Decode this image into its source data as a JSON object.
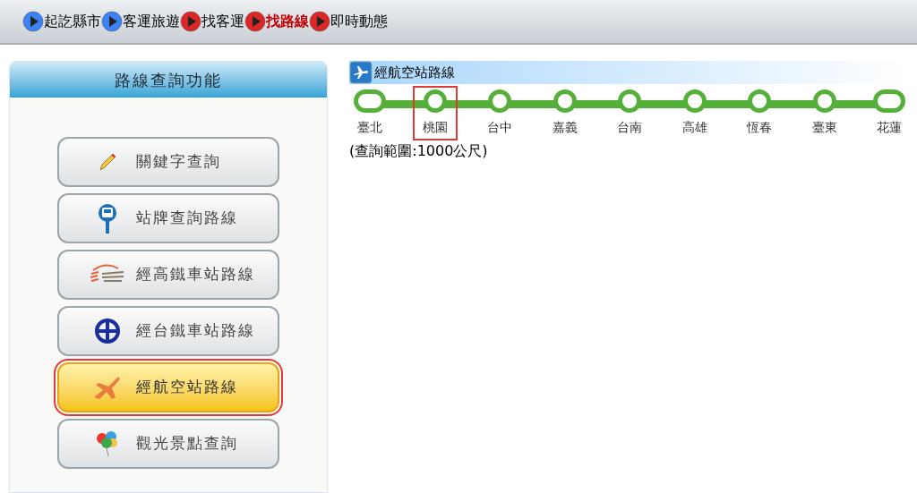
{
  "nav": [
    {
      "label": "起訖縣市",
      "color": "#3b82f6",
      "selected": false
    },
    {
      "label": "客運旅遊",
      "color": "#3b82f6",
      "selected": false
    },
    {
      "label": "找客運",
      "color": "#dc2626",
      "selected": false
    },
    {
      "label": "找路線",
      "color": "#dc2626",
      "selected": true
    },
    {
      "label": "即時動態",
      "color": "#dc2626",
      "selected": false
    }
  ],
  "sidebar": {
    "title": "路線查詢功能",
    "items": [
      {
        "label": "關鍵字查詢",
        "kind": "pencil",
        "selected": false
      },
      {
        "label": "站牌查詢路線",
        "kind": "bus",
        "selected": false
      },
      {
        "label": "經高鐵車站路線",
        "kind": "hsr",
        "selected": false
      },
      {
        "label": "經台鐵車站路線",
        "kind": "tra",
        "selected": false
      },
      {
        "label": "經航空站路線",
        "kind": "plane",
        "selected": true
      },
      {
        "label": "觀光景點查詢",
        "kind": "balloons",
        "selected": false
      }
    ]
  },
  "content": {
    "title": "經航空站路線",
    "stations": [
      {
        "label": "臺北",
        "selected": false
      },
      {
        "label": "桃園",
        "selected": true
      },
      {
        "label": "台中",
        "selected": false
      },
      {
        "label": "嘉義",
        "selected": false
      },
      {
        "label": "台南",
        "selected": false
      },
      {
        "label": "高雄",
        "selected": false
      },
      {
        "label": "恆春",
        "selected": false
      },
      {
        "label": "臺東",
        "selected": false
      },
      {
        "label": "花蓮",
        "selected": false
      }
    ],
    "range_note": "(查詢範圍:1000公尺)"
  }
}
